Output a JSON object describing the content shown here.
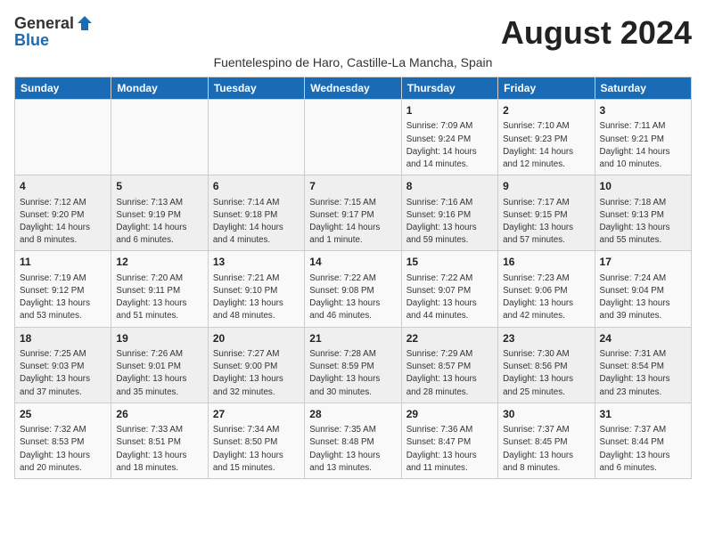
{
  "logo": {
    "general": "General",
    "blue": "Blue"
  },
  "title": "August 2024",
  "location": "Fuentelespino de Haro, Castille-La Mancha, Spain",
  "columns": [
    "Sunday",
    "Monday",
    "Tuesday",
    "Wednesday",
    "Thursday",
    "Friday",
    "Saturday"
  ],
  "weeks": [
    [
      {
        "day": "",
        "info": ""
      },
      {
        "day": "",
        "info": ""
      },
      {
        "day": "",
        "info": ""
      },
      {
        "day": "",
        "info": ""
      },
      {
        "day": "1",
        "info": "Sunrise: 7:09 AM\nSunset: 9:24 PM\nDaylight: 14 hours\nand 14 minutes."
      },
      {
        "day": "2",
        "info": "Sunrise: 7:10 AM\nSunset: 9:23 PM\nDaylight: 14 hours\nand 12 minutes."
      },
      {
        "day": "3",
        "info": "Sunrise: 7:11 AM\nSunset: 9:21 PM\nDaylight: 14 hours\nand 10 minutes."
      }
    ],
    [
      {
        "day": "4",
        "info": "Sunrise: 7:12 AM\nSunset: 9:20 PM\nDaylight: 14 hours\nand 8 minutes."
      },
      {
        "day": "5",
        "info": "Sunrise: 7:13 AM\nSunset: 9:19 PM\nDaylight: 14 hours\nand 6 minutes."
      },
      {
        "day": "6",
        "info": "Sunrise: 7:14 AM\nSunset: 9:18 PM\nDaylight: 14 hours\nand 4 minutes."
      },
      {
        "day": "7",
        "info": "Sunrise: 7:15 AM\nSunset: 9:17 PM\nDaylight: 14 hours\nand 1 minute."
      },
      {
        "day": "8",
        "info": "Sunrise: 7:16 AM\nSunset: 9:16 PM\nDaylight: 13 hours\nand 59 minutes."
      },
      {
        "day": "9",
        "info": "Sunrise: 7:17 AM\nSunset: 9:15 PM\nDaylight: 13 hours\nand 57 minutes."
      },
      {
        "day": "10",
        "info": "Sunrise: 7:18 AM\nSunset: 9:13 PM\nDaylight: 13 hours\nand 55 minutes."
      }
    ],
    [
      {
        "day": "11",
        "info": "Sunrise: 7:19 AM\nSunset: 9:12 PM\nDaylight: 13 hours\nand 53 minutes."
      },
      {
        "day": "12",
        "info": "Sunrise: 7:20 AM\nSunset: 9:11 PM\nDaylight: 13 hours\nand 51 minutes."
      },
      {
        "day": "13",
        "info": "Sunrise: 7:21 AM\nSunset: 9:10 PM\nDaylight: 13 hours\nand 48 minutes."
      },
      {
        "day": "14",
        "info": "Sunrise: 7:22 AM\nSunset: 9:08 PM\nDaylight: 13 hours\nand 46 minutes."
      },
      {
        "day": "15",
        "info": "Sunrise: 7:22 AM\nSunset: 9:07 PM\nDaylight: 13 hours\nand 44 minutes."
      },
      {
        "day": "16",
        "info": "Sunrise: 7:23 AM\nSunset: 9:06 PM\nDaylight: 13 hours\nand 42 minutes."
      },
      {
        "day": "17",
        "info": "Sunrise: 7:24 AM\nSunset: 9:04 PM\nDaylight: 13 hours\nand 39 minutes."
      }
    ],
    [
      {
        "day": "18",
        "info": "Sunrise: 7:25 AM\nSunset: 9:03 PM\nDaylight: 13 hours\nand 37 minutes."
      },
      {
        "day": "19",
        "info": "Sunrise: 7:26 AM\nSunset: 9:01 PM\nDaylight: 13 hours\nand 35 minutes."
      },
      {
        "day": "20",
        "info": "Sunrise: 7:27 AM\nSunset: 9:00 PM\nDaylight: 13 hours\nand 32 minutes."
      },
      {
        "day": "21",
        "info": "Sunrise: 7:28 AM\nSunset: 8:59 PM\nDaylight: 13 hours\nand 30 minutes."
      },
      {
        "day": "22",
        "info": "Sunrise: 7:29 AM\nSunset: 8:57 PM\nDaylight: 13 hours\nand 28 minutes."
      },
      {
        "day": "23",
        "info": "Sunrise: 7:30 AM\nSunset: 8:56 PM\nDaylight: 13 hours\nand 25 minutes."
      },
      {
        "day": "24",
        "info": "Sunrise: 7:31 AM\nSunset: 8:54 PM\nDaylight: 13 hours\nand 23 minutes."
      }
    ],
    [
      {
        "day": "25",
        "info": "Sunrise: 7:32 AM\nSunset: 8:53 PM\nDaylight: 13 hours\nand 20 minutes."
      },
      {
        "day": "26",
        "info": "Sunrise: 7:33 AM\nSunset: 8:51 PM\nDaylight: 13 hours\nand 18 minutes."
      },
      {
        "day": "27",
        "info": "Sunrise: 7:34 AM\nSunset: 8:50 PM\nDaylight: 13 hours\nand 15 minutes."
      },
      {
        "day": "28",
        "info": "Sunrise: 7:35 AM\nSunset: 8:48 PM\nDaylight: 13 hours\nand 13 minutes."
      },
      {
        "day": "29",
        "info": "Sunrise: 7:36 AM\nSunset: 8:47 PM\nDaylight: 13 hours\nand 11 minutes."
      },
      {
        "day": "30",
        "info": "Sunrise: 7:37 AM\nSunset: 8:45 PM\nDaylight: 13 hours\nand 8 minutes."
      },
      {
        "day": "31",
        "info": "Sunrise: 7:37 AM\nSunset: 8:44 PM\nDaylight: 13 hours\nand 6 minutes."
      }
    ]
  ]
}
